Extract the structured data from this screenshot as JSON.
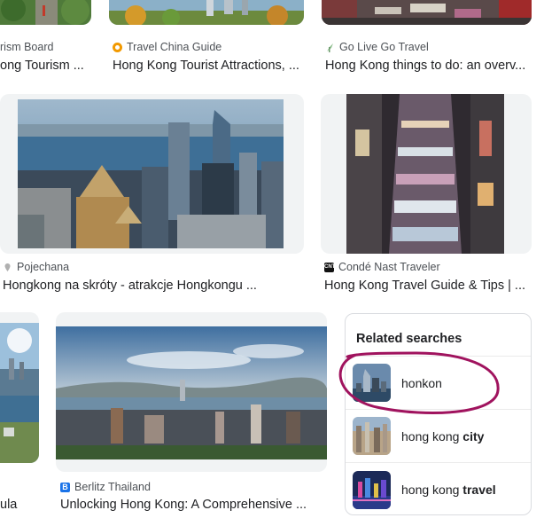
{
  "results": [
    {
      "source": "rism Board",
      "title": "ong Tourism ...",
      "favicon_color": "#9e9e9e",
      "favicon_icon": "none"
    },
    {
      "source": "Travel China Guide",
      "title": "Hong Kong Tourist Attractions, ...",
      "favicon_color": "#f29900",
      "favicon_icon": "compass-icon"
    },
    {
      "source": "Go Live Go Travel",
      "title": "Hong Kong things to do: an overv...",
      "favicon_color": "#8fbf8f",
      "favicon_icon": "leaf-icon"
    },
    {
      "source": "Pojechana",
      "title": "Hongkong na skróty - atrakcje Hongkongu ...",
      "favicon_color": "#b0b0b0",
      "favicon_icon": "pin-icon"
    },
    {
      "source": "Condé Nast Traveler",
      "title": "Hong Kong Travel Guide & Tips | ...",
      "favicon_color": "#111111",
      "favicon_icon": "cnt-logo-icon"
    },
    {
      "source": "",
      "title": "ula",
      "favicon_color": "",
      "favicon_icon": "none"
    },
    {
      "source": "Berlitz Thailand",
      "title": "Unlocking Hong Kong: A Comprehensive ...",
      "favicon_color": "#1a73e8",
      "favicon_icon": "berlitz-b-icon"
    }
  ],
  "favicon_text": {
    "cnt": "CNT",
    "berlitz": "B"
  },
  "related": {
    "heading": "Related searches",
    "items": [
      {
        "normal": "honkon",
        "bold": "",
        "annotated": true
      },
      {
        "normal": "hong kong ",
        "bold": "city",
        "annotated": false
      },
      {
        "normal": "hong kong ",
        "bold": "travel",
        "annotated": false
      }
    ],
    "annotation_color": "#a0135e"
  }
}
